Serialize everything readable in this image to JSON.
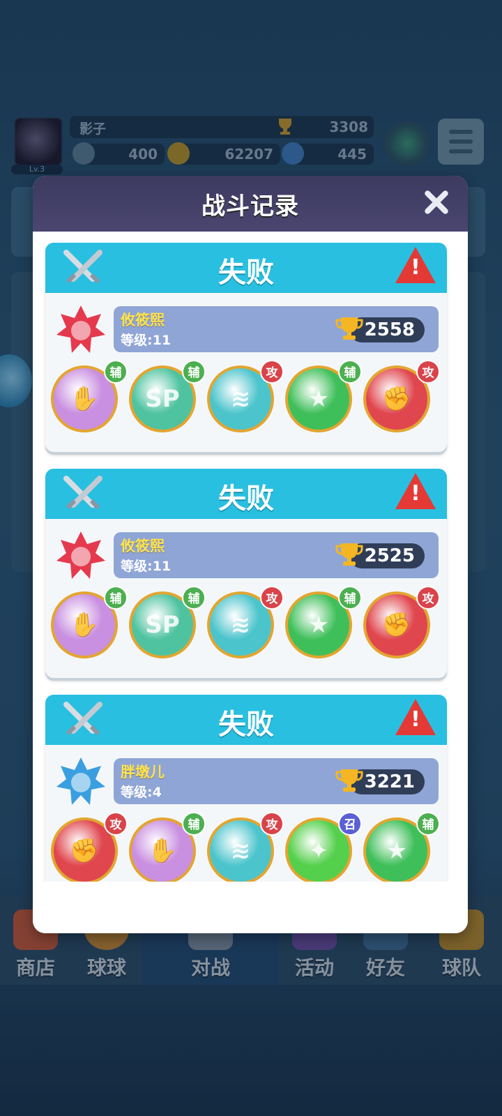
{
  "background": {
    "player": {
      "name": "影子",
      "level": "Lv.3",
      "trophies": "3308"
    },
    "resources": [
      {
        "icon": "ticket-icon",
        "value": "400"
      },
      {
        "icon": "gold-coin-icon",
        "value": "62207"
      },
      {
        "icon": "gem-icon",
        "value": "445"
      }
    ],
    "nav": [
      {
        "label": "商店",
        "icon": "shop-icon"
      },
      {
        "label": "球球",
        "icon": "ball-icon"
      },
      {
        "label": "对战",
        "icon": "battle-icon"
      },
      {
        "label": "活动",
        "icon": "party-icon"
      },
      {
        "label": "好友",
        "icon": "friends-icon"
      },
      {
        "label": "球队",
        "icon": "whistle-icon"
      }
    ]
  },
  "modal": {
    "title": "战斗记录",
    "records": [
      {
        "result": "失败",
        "opponent": "攸筱熙",
        "level": "等级:11",
        "trophies": "2558",
        "rank_badge": "red-star-badge-icon",
        "balls": [
          {
            "icon": "rainbow-hands-ball-icon",
            "tag": "辅",
            "color": "#c98fe0"
          },
          {
            "icon": "sp-ball-icon",
            "tag": "辅",
            "color": "#4fc3a0"
          },
          {
            "icon": "tornado-ball-icon",
            "tag": "攻",
            "color": "#4cc4cc"
          },
          {
            "icon": "green-star-arrow-ball-icon",
            "tag": "辅",
            "color": "#3fbf5a"
          },
          {
            "icon": "red-fist-ball-icon",
            "tag": "攻",
            "color": "#e0464e"
          }
        ]
      },
      {
        "result": "失败",
        "opponent": "攸筱熙",
        "level": "等级:11",
        "trophies": "2525",
        "rank_badge": "red-star-badge-icon",
        "balls": [
          {
            "icon": "rainbow-hands-ball-icon",
            "tag": "辅",
            "color": "#c98fe0"
          },
          {
            "icon": "sp-ball-icon",
            "tag": "辅",
            "color": "#4fc3a0"
          },
          {
            "icon": "tornado-ball-icon",
            "tag": "攻",
            "color": "#4cc4cc"
          },
          {
            "icon": "green-star-arrow-ball-icon",
            "tag": "辅",
            "color": "#3fbf5a"
          },
          {
            "icon": "red-fist-ball-icon",
            "tag": "攻",
            "color": "#e0464e"
          }
        ]
      },
      {
        "result": "失败",
        "opponent": "胖墩儿",
        "level": "等级:4",
        "trophies": "3221",
        "rank_badge": "blue-star-badge-icon",
        "balls": [
          {
            "icon": "red-fist-ball-icon",
            "tag": "攻",
            "color": "#e0464e"
          },
          {
            "icon": "rainbow-hands-ball-icon",
            "tag": "辅",
            "color": "#c98fe0"
          },
          {
            "icon": "tornado-ball-icon",
            "tag": "攻",
            "color": "#4cc4cc"
          },
          {
            "icon": "green-hex-ball-icon",
            "tag": "召",
            "color": "#55d04c"
          },
          {
            "icon": "green-star-arrow-ball-icon",
            "tag": "辅",
            "color": "#3fbf5a"
          }
        ]
      }
    ]
  },
  "colors": {
    "attack_tag": "#d9434a",
    "support_tag": "#4caf50",
    "summon_tag": "#5b5fd6",
    "header": "#29bfe0"
  }
}
